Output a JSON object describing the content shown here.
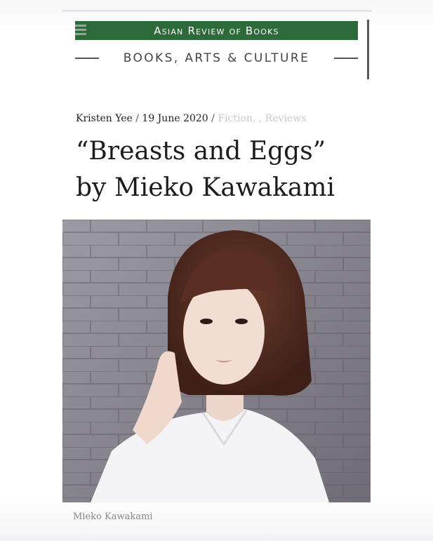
{
  "header": {
    "site_title": "Asian Review of Books",
    "tagline": "BOOKS, ARTS & CULTURE",
    "brand_color": "#2d6a3a"
  },
  "article": {
    "author": "Kristen Yee",
    "date": "19 June 2020",
    "categories": "Fiction, , Reviews",
    "title_line1": "“Breasts and Eggs”",
    "title_line2": "by Mieko Kawakami",
    "image_caption": "Mieko Kawakami"
  },
  "icons": {
    "menu": "hamburger-menu-icon"
  }
}
